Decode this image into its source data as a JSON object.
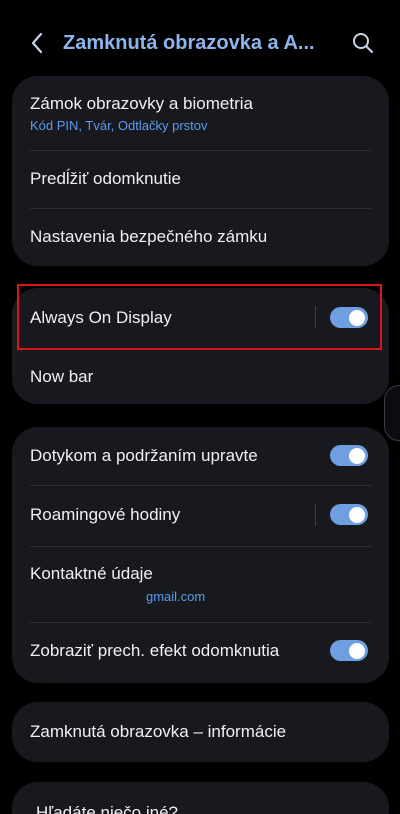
{
  "header": {
    "title": "Zamknutá obrazovka a A...",
    "back_icon": "chevron-left-icon",
    "search_icon": "search-icon"
  },
  "colors": {
    "accent": "#8fb4ec",
    "toggle_on": "#6f9fe0",
    "subtext": "#5e9bea",
    "card_bg": "#17191e",
    "highlight": "#d9141b"
  },
  "group1": {
    "screen_lock": {
      "title": "Zámok obrazovky a biometria",
      "subtitle": "Kód PIN, Tvár, Odtlačky prstov"
    },
    "extend_unlock": {
      "title": "Predĺžiť odomknutie"
    },
    "secure_lock_settings": {
      "title": "Nastavenia bezpečného zámku"
    }
  },
  "group2": {
    "always_on_display": {
      "title": "Always On Display",
      "enabled": true
    },
    "now_bar": {
      "title": "Now bar"
    }
  },
  "group3": {
    "touch_and_hold": {
      "title": "Dotykom a podržaním upravte",
      "enabled": true
    },
    "roaming_clock": {
      "title": "Roamingové hodiny",
      "enabled": true
    },
    "contact_info": {
      "title": "Kontaktné údaje",
      "subtitle": "gmail.com"
    },
    "unlock_transition": {
      "title": "Zobraziť prech. efekt odomknutia",
      "enabled": true
    }
  },
  "group4": {
    "about_lock_screen": {
      "title": "Zamknutá obrazovka – informácie"
    }
  },
  "group5": {
    "looking_for_else": {
      "title": "Hľadáte niečo iné?"
    }
  }
}
